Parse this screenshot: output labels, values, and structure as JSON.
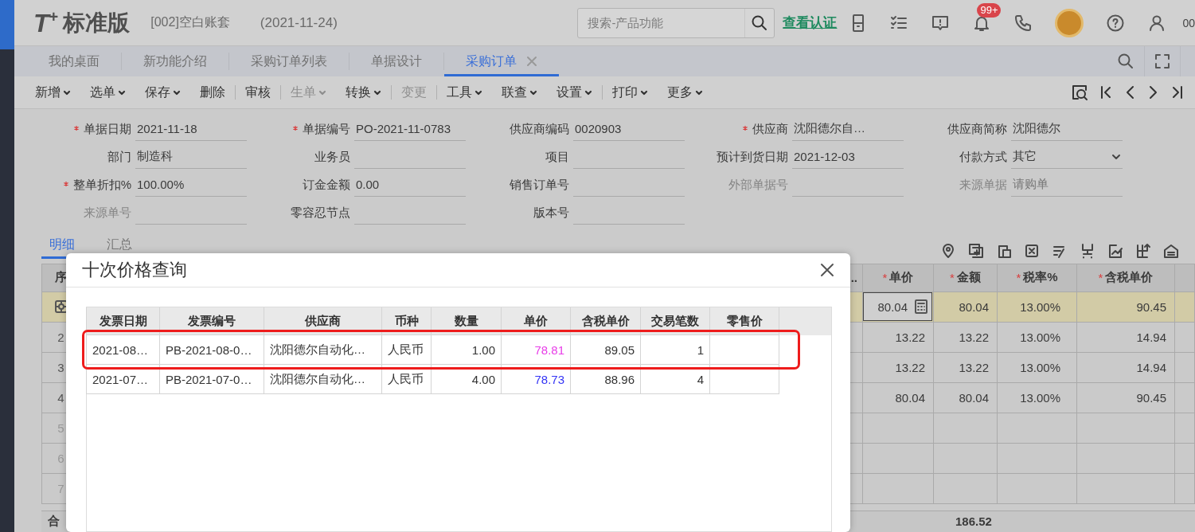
{
  "app_header": {
    "logo": "T",
    "logo_plus": "+",
    "edition": "标准版",
    "account": "[002]空白账套",
    "date": "(2021-11-24)",
    "search": {
      "placeholder": "搜索-产品功能"
    },
    "verify_link": "查看认证",
    "notification_count": "99+",
    "user_label": "00"
  },
  "tabs": [
    {
      "label": "我的桌面",
      "selected": false,
      "closable": false
    },
    {
      "label": "新功能介绍",
      "selected": false,
      "closable": false
    },
    {
      "label": "采购订单列表",
      "selected": false,
      "closable": false
    },
    {
      "label": "单据设计",
      "selected": false,
      "closable": false
    },
    {
      "label": "采购订单",
      "selected": true,
      "closable": true
    }
  ],
  "toolbar": [
    {
      "label": "新增",
      "dropdown": true,
      "disabled": false,
      "divider": false
    },
    {
      "label": "选单",
      "dropdown": true,
      "disabled": false,
      "divider": false
    },
    {
      "label": "保存",
      "dropdown": true,
      "disabled": false,
      "divider": false
    },
    {
      "label": "删除",
      "dropdown": false,
      "disabled": false,
      "divider": true
    },
    {
      "label": "审核",
      "dropdown": false,
      "disabled": false,
      "divider": true
    },
    {
      "label": "生单",
      "dropdown": true,
      "disabled": true,
      "divider": false
    },
    {
      "label": "转换",
      "dropdown": true,
      "disabled": false,
      "divider": true
    },
    {
      "label": "变更",
      "dropdown": false,
      "disabled": true,
      "divider": true
    },
    {
      "label": "工具",
      "dropdown": true,
      "disabled": false,
      "divider": false
    },
    {
      "label": "联查",
      "dropdown": true,
      "disabled": false,
      "divider": false
    },
    {
      "label": "设置",
      "dropdown": true,
      "disabled": false,
      "divider": true
    },
    {
      "label": "打印",
      "dropdown": true,
      "disabled": false,
      "divider": false
    },
    {
      "label": "更多",
      "dropdown": true,
      "disabled": false,
      "divider": false
    }
  ],
  "form": [
    [
      {
        "label": "单据日期",
        "required": true,
        "disabled": false,
        "value": "2021-11-18",
        "dropdown": false
      },
      {
        "label": "单据编号",
        "required": true,
        "disabled": false,
        "value": "PO-2021-11-0783",
        "dropdown": false
      },
      {
        "label": "供应商编码",
        "required": false,
        "disabled": false,
        "value": "0020903",
        "dropdown": false
      },
      {
        "label": "供应商",
        "required": true,
        "disabled": false,
        "value": "沈阳德尔自…",
        "dropdown": false
      },
      {
        "label": "供应商简称",
        "required": false,
        "disabled": false,
        "value": "沈阳德尔",
        "dropdown": false
      }
    ],
    [
      {
        "label": "部门",
        "required": false,
        "disabled": false,
        "value": "制造科",
        "dropdown": false
      },
      {
        "label": "业务员",
        "required": false,
        "disabled": false,
        "dropdown": false
      },
      {
        "label": "项目",
        "required": false,
        "disabled": false,
        "dropdown": false
      },
      {
        "label": "预计到货日期",
        "required": false,
        "disabled": false,
        "value": "2021-12-03",
        "dropdown": false
      },
      {
        "label": "付款方式",
        "required": false,
        "disabled": false,
        "value": "其它",
        "dropdown": true
      }
    ],
    [
      {
        "label": "整单折扣%",
        "required": true,
        "disabled": false,
        "value": "100.00%",
        "dropdown": false
      },
      {
        "label": "订金金额",
        "required": false,
        "disabled": false,
        "value": "0.00",
        "dropdown": false
      },
      {
        "label": "销售订单号",
        "required": false,
        "disabled": false,
        "dropdown": false
      },
      {
        "label": "外部单据号",
        "required": false,
        "disabled": true,
        "dropdown": false
      },
      {
        "label": "来源单据",
        "required": false,
        "disabled": true,
        "value": "请购单",
        "dropdown": false
      }
    ],
    [
      {
        "label": "来源单号",
        "required": false,
        "disabled": true,
        "dropdown": false
      },
      {
        "label": "零容忍节点",
        "required": false,
        "disabled": false,
        "dropdown": false
      },
      {
        "label": "版本号",
        "required": false,
        "disabled": false,
        "dropdown": false
      }
    ]
  ],
  "detail_tabs": [
    {
      "label": "明细",
      "selected": true
    },
    {
      "label": "汇总",
      "selected": false
    }
  ],
  "grid": {
    "columns": [
      {
        "label": "序"
      },
      {
        "label": ".."
      },
      {
        "mark": "*",
        "label": "单价"
      },
      {
        "mark": "*",
        "label": "金额"
      },
      {
        "mark": "*",
        "label": "税率%"
      },
      {
        "mark": "*",
        "label": "含税单价"
      },
      {}
    ],
    "rows": [
      {
        "kind": "current",
        "selected": true,
        "editing": true,
        "values": [
          "80.04",
          "80.04",
          "13.00%",
          "90.45"
        ]
      },
      {
        "kind": "line",
        "index": "2",
        "selected": false,
        "editing": false,
        "values": [
          "13.22",
          "13.22",
          "13.00%",
          "14.94"
        ]
      },
      {
        "kind": "line",
        "index": "3",
        "selected": false,
        "editing": false,
        "values": [
          "13.22",
          "13.22",
          "13.00%",
          "14.94"
        ]
      },
      {
        "kind": "line",
        "index": "4",
        "selected": false,
        "editing": false,
        "values": [
          "80.04",
          "80.04",
          "13.00%",
          "90.45"
        ]
      },
      {
        "kind": "blank",
        "index": "5",
        "selected": false,
        "editing": false
      },
      {
        "kind": "blank",
        "index": "6",
        "selected": false,
        "editing": false
      },
      {
        "kind": "blank",
        "index": "7",
        "selected": false,
        "editing": false
      }
    ],
    "totals": {
      "label": "合",
      "amount": "186.52"
    }
  },
  "price_query": {
    "title": "十次价格查询",
    "columns": [
      "发票日期",
      "发票编号",
      "供应商",
      "币种",
      "数量",
      "单价",
      "含税单价",
      "交易笔数",
      "零售价"
    ],
    "rows": [
      {
        "cells": [
          "2021-08…",
          "PB-2021-08-0…",
          "沈阳德尔自动化…",
          "人民币",
          "1.00",
          "78.81",
          "89.05",
          "1"
        ],
        "color": "#e83de8",
        "highlighted": true
      },
      {
        "cells": [
          "2021-07…",
          "PB-2021-07-0…",
          "沈阳德尔自动化…",
          "人民币",
          "4.00",
          "78.73",
          "88.96",
          "4"
        ],
        "color": "#3535f5",
        "highlighted": false
      }
    ]
  }
}
